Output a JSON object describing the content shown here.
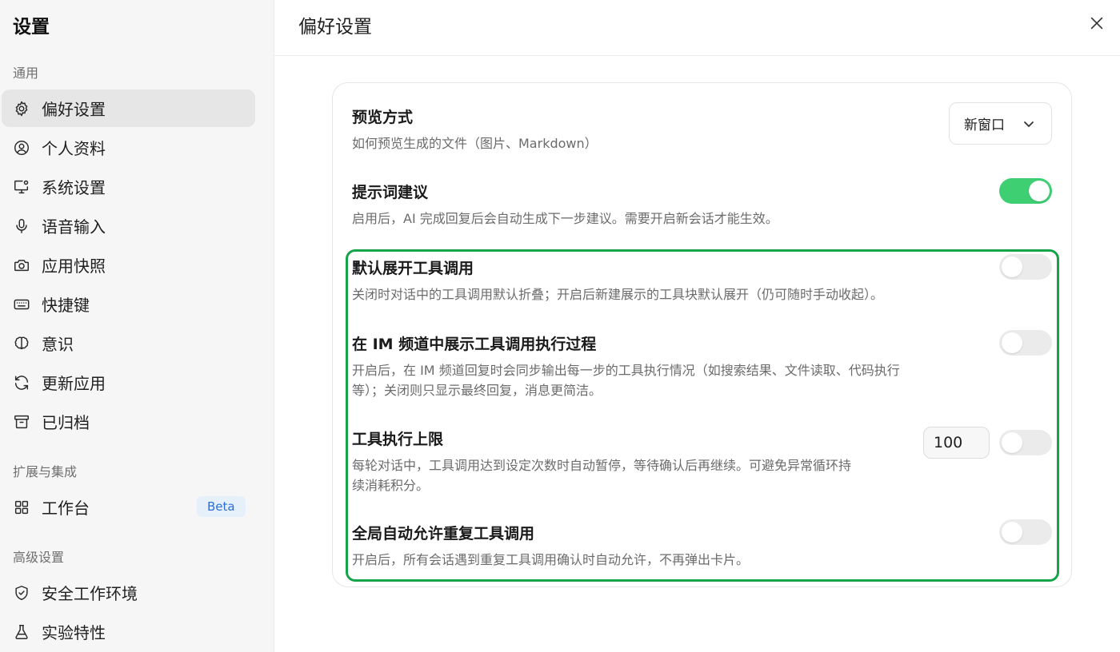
{
  "sidebar": {
    "title": "设置",
    "sections": {
      "general": "通用",
      "extensions": "扩展与集成",
      "advanced": "高级设置"
    },
    "items": [
      {
        "label": "偏好设置",
        "icon": "gear-icon"
      },
      {
        "label": "个人资料",
        "icon": "user-circle-icon"
      },
      {
        "label": "系统设置",
        "icon": "monitor-settings-icon"
      },
      {
        "label": "语音输入",
        "icon": "microphone-icon"
      },
      {
        "label": "应用快照",
        "icon": "camera-icon"
      },
      {
        "label": "快捷键",
        "icon": "keyboard-icon"
      },
      {
        "label": "意识",
        "icon": "brain-icon"
      },
      {
        "label": "更新应用",
        "icon": "refresh-icon"
      },
      {
        "label": "已归档",
        "icon": "archive-icon"
      },
      {
        "label": "工作台",
        "icon": "grid-icon",
        "badge": "Beta"
      },
      {
        "label": "安全工作环境",
        "icon": "shield-icon"
      },
      {
        "label": "实验特性",
        "icon": "flask-icon"
      }
    ]
  },
  "main": {
    "title": "偏好设置",
    "preview": {
      "title": "预览方式",
      "desc": "如何预览生成的文件（图片、Markdown）",
      "selected": "新窗口"
    },
    "prompt_suggest": {
      "title": "提示词建议",
      "desc": "启用后，AI 完成回复后会自动生成下一步建议。需要开启新会话才能生效。",
      "on": true
    },
    "expand_tools": {
      "title": "默认展开工具调用",
      "desc": "关闭时对话中的工具调用默认折叠；开启后新建展示的工具块默认展开（仍可随时手动收起）。",
      "on": false
    },
    "im_tools": {
      "title": "在 IM 频道中展示工具调用执行过程",
      "desc_line1": "开启后，在 IM 频道回复时会同步输出每一步的工具执行情况（如搜索结果、文件读取、代码执行",
      "desc_line2": "等）；关闭则只显示最终回复，消息更简洁。",
      "on": false
    },
    "tool_limit": {
      "title": "工具执行上限",
      "desc_line1": "每轮对话中，工具调用达到设定次数时自动暂停，等待确认后再继续。可避免异常循环持",
      "desc_line2": "续消耗积分。",
      "value": "100",
      "on": false
    },
    "auto_allow": {
      "title": "全局自动允许重复工具调用",
      "desc": "开启后，所有会话遇到重复工具调用确认时自动允许，不再弹出卡片。",
      "on": false
    }
  },
  "colors": {
    "accent_toggle_on": "#3ecf73",
    "highlight_border": "#16a34a",
    "beta_text": "#2b6fd6"
  }
}
